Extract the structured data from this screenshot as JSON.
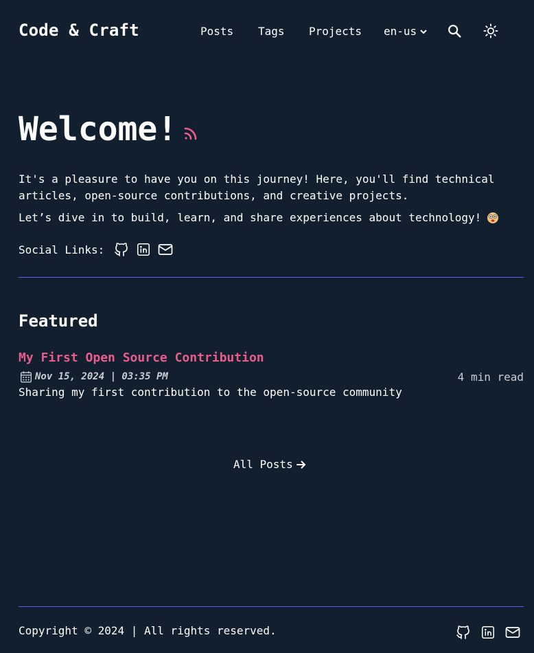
{
  "site": {
    "title": "Code & Craft"
  },
  "nav": {
    "items": [
      {
        "label": "Posts"
      },
      {
        "label": "Tags"
      },
      {
        "label": "Projects"
      }
    ],
    "language": "en-us"
  },
  "hero": {
    "heading": "Welcome!",
    "intro": "It's a pleasure to have you on this journey! Here, you'll find technical articles, open-source contributions, and creative projects.",
    "intro2": "Let’s dive in to build, learn, and share experiences about technology!",
    "social_label": "Social Links:"
  },
  "featured": {
    "heading": "Featured",
    "posts": [
      {
        "title": "My First Open Source Contribution",
        "date": "Nov 15, 2024 | 03:35 PM",
        "read_time": "4 min read",
        "description": "Sharing my first contribution to the open-source community"
      }
    ]
  },
  "all_posts_label": "All Posts",
  "footer": {
    "copyright": "Copyright © 2024 | All rights reserved."
  },
  "colors": {
    "background": "#111f2e",
    "accent": "#ea5c8c",
    "divider": "#5b5ff0",
    "text": "#ffffff"
  },
  "icons": [
    "search-icon",
    "sun-icon",
    "rss-icon",
    "github-icon",
    "linkedin-icon",
    "mail-icon",
    "calendar-icon",
    "arrow-right-icon",
    "chevron-down-icon",
    "emoji-face-icon"
  ]
}
